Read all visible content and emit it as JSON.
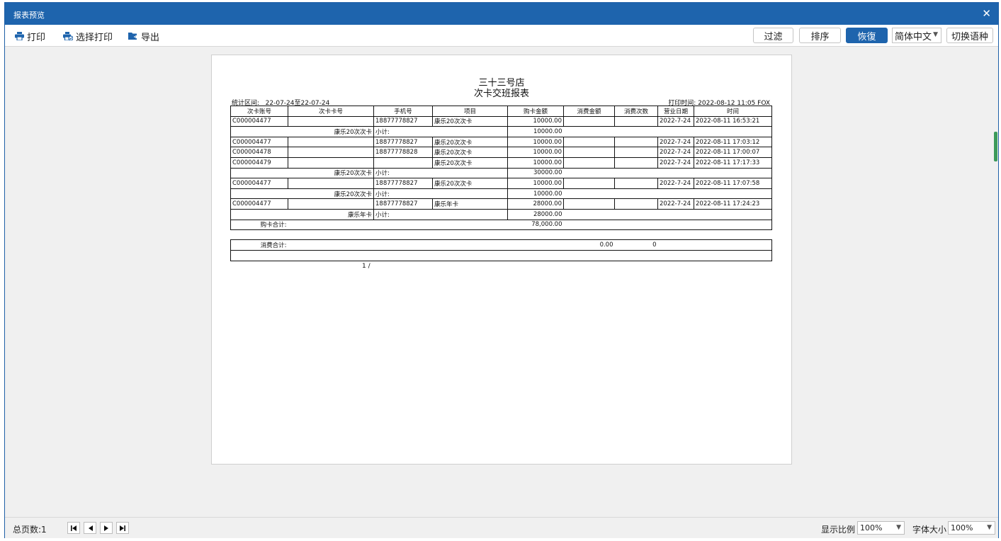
{
  "window": {
    "title": "报表预览"
  },
  "toolbar": {
    "print_label": "打印",
    "select_print_label": "选择打印",
    "export_label": "导出",
    "filter_label": "过滤",
    "sort_label": "排序",
    "restore_label": "恢復",
    "language_value": "简体中文",
    "switch_language_label": "切换语种"
  },
  "report": {
    "shop_name": "三十三号店",
    "title": "次卡交班报表",
    "period_label": "统计区间:",
    "period_value": "22-07-24至22-07-24",
    "print_time": "打印时间: 2022-08-12 11:05 FOX",
    "columns": [
      "次卡账号",
      "次卡卡号",
      "手机号",
      "项目",
      "购卡金额",
      "消费金额",
      "消费次数",
      "营业日期",
      "时间"
    ],
    "rows": [
      {
        "account": "C000004477",
        "card": "",
        "phone": "18877778827",
        "item": "康乐20次次卡",
        "amount": "10000.00",
        "consume_amount": "",
        "consume_count": "",
        "date": "2022-7-24",
        "time": "2022-08-11 16:53:21"
      },
      {
        "subtotal_name": "康乐20次次卡",
        "subtotal_label": "小计:",
        "subtotal_amount": "10000.00"
      },
      {
        "account": "C000004477",
        "card": "",
        "phone": "18877778827",
        "item": "康乐20次次卡",
        "amount": "10000.00",
        "consume_amount": "",
        "consume_count": "",
        "date": "2022-7-24",
        "time": "2022-08-11 17:03:12"
      },
      {
        "account": "C000004478",
        "card": "",
        "phone": "18877778828",
        "item": "康乐20次次卡",
        "amount": "10000.00",
        "consume_amount": "",
        "consume_count": "",
        "date": "2022-7-24",
        "time": "2022-08-11 17:00:07"
      },
      {
        "account": "C000004479",
        "card": "",
        "phone": "",
        "item": "康乐20次次卡",
        "amount": "10000.00",
        "consume_amount": "",
        "consume_count": "",
        "date": "2022-7-24",
        "time": "2022-08-11 17:17:33"
      },
      {
        "subtotal_name": "康乐20次次卡",
        "subtotal_label": "小计:",
        "subtotal_amount": "30000.00"
      },
      {
        "account": "C000004477",
        "card": "",
        "phone": "18877778827",
        "item": "康乐20次次卡",
        "amount": "10000.00",
        "consume_amount": "",
        "consume_count": "",
        "date": "2022-7-24",
        "time": "2022-08-11 17:07:58"
      },
      {
        "subtotal_name": "康乐20次次卡",
        "subtotal_label": "小计:",
        "subtotal_amount": "10000.00"
      },
      {
        "account": "C000004477",
        "card": "",
        "phone": "18877778827",
        "item": "康乐年卡",
        "amount": "28000.00",
        "consume_amount": "",
        "consume_count": "",
        "date": "2022-7-24",
        "time": "2022-08-11 17:24:23"
      },
      {
        "subtotal_name": "康乐年卡",
        "subtotal_label": "小计:",
        "subtotal_amount": "28000.00"
      }
    ],
    "purchase_total_label": "购卡合计:",
    "purchase_total_value": "78,000.00",
    "consume_total_label": "消费合计:",
    "consume_total_amount": "0.00",
    "consume_total_count": "0",
    "page_indicator": "1 /"
  },
  "status": {
    "total_pages": "总页数:1",
    "zoom_label": "显示比例",
    "zoom_value": "100%",
    "font_size_label": "字体大小",
    "font_size_value": "100%"
  },
  "icons": {
    "print": "printer-icon",
    "select_print": "select-print-icon",
    "export": "export-folder-icon",
    "close": "close-icon",
    "nav_first": "first-page-icon",
    "nav_prev": "prev-page-icon",
    "nav_next": "next-page-icon",
    "nav_last": "last-page-icon"
  },
  "colors": {
    "titlebar": "#1e64ad",
    "active_button": "#1e64ad",
    "scroll_thumb": "#3c9a5a"
  }
}
